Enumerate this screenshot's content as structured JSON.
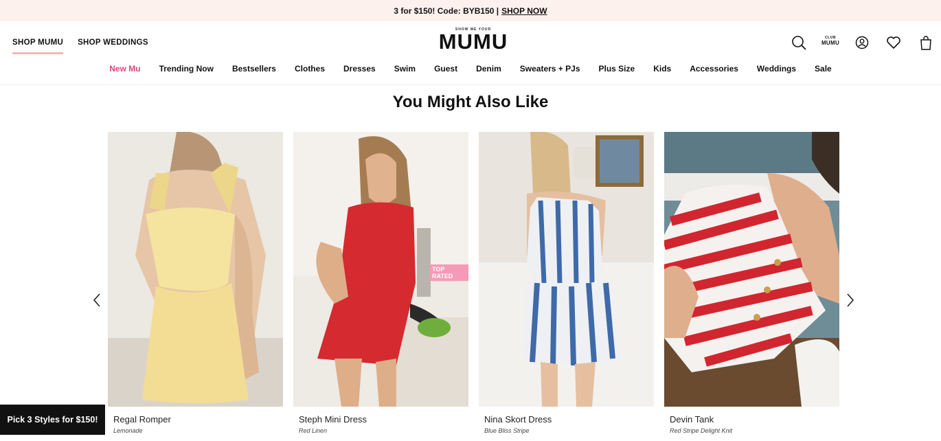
{
  "promo_bar": {
    "text": "3 for $150! Code: BYB150 |",
    "link": "SHOP NOW"
  },
  "shop_tabs": [
    "SHOP MUMU",
    "SHOP WEDDINGS"
  ],
  "logo": {
    "tagline": "SHOW ME YOUR",
    "name": "MUMU"
  },
  "header_icons": {
    "search": "search-icon",
    "club_line1": "CLUB",
    "club_line2": "MUMU",
    "account": "account-icon",
    "wishlist": "heart-icon",
    "bag": "bag-icon"
  },
  "nav": [
    "New Mu",
    "Trending Now",
    "Bestsellers",
    "Clothes",
    "Dresses",
    "Swim",
    "Guest",
    "Denim",
    "Sweaters + PJs",
    "Plus Size",
    "Kids",
    "Accessories",
    "Weddings",
    "Sale"
  ],
  "section_title": "You Might Also Like",
  "products": [
    {
      "name": "Regal Romper",
      "color": "Lemonade"
    },
    {
      "name": "Steph Mini Dress",
      "color": "Red Linen",
      "badge": "TOP RATED"
    },
    {
      "name": "Nina Skort Dress",
      "color": "Blue Bliss Stripe"
    },
    {
      "name": "Devin Tank",
      "color": "Red Stripe Delight Knit"
    }
  ],
  "sticky_promo": "Pick 3 Styles for $150!",
  "colors": {
    "promo_bg": "#fdf1ee",
    "accent_pink": "#e0457b",
    "badge_pink": "#f49bb7"
  }
}
